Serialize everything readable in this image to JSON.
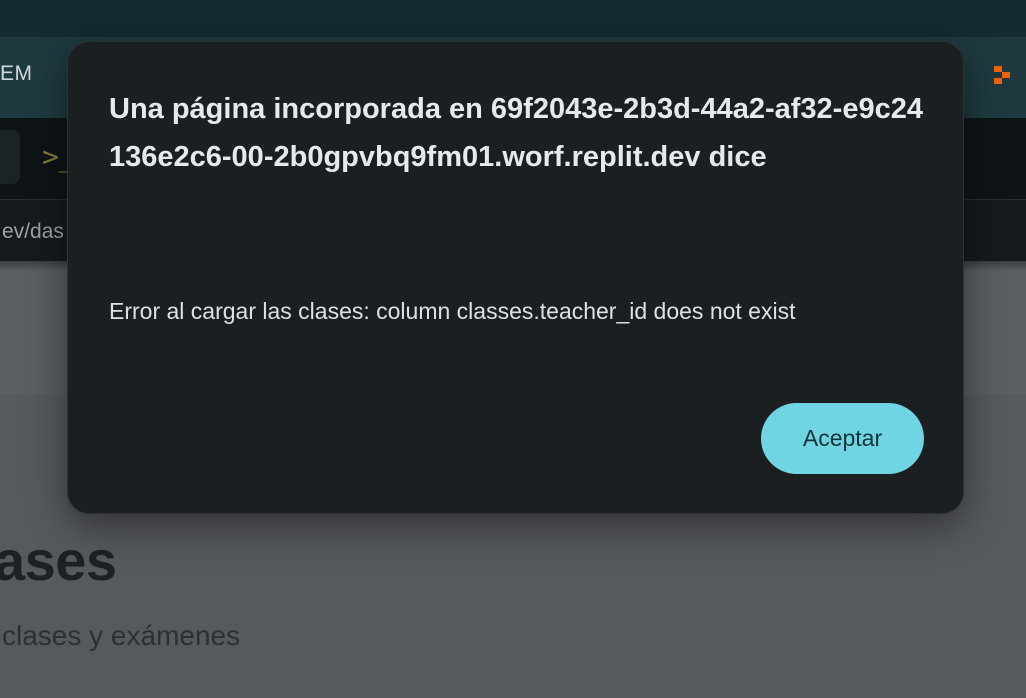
{
  "browser": {
    "tab_text_partial": "EM",
    "terminal_glyph": ">_",
    "url_partial": "ev/das",
    "extension_icon": "replit-logo-icon"
  },
  "page": {
    "title_partial": "ases",
    "subtitle_partial": "clases y exámenes"
  },
  "dialog": {
    "title": "Una página incorporada en 69f2043e-2b3d-44a2-af32-e9c24136e2c6-00-2b0gpvbq9fm01.worf.replit.dev dice",
    "message": "Error al cargar las clases: column classes.teacher_id does not exist",
    "button_label": "Aceptar",
    "button_color": "#6fd5e3"
  }
}
